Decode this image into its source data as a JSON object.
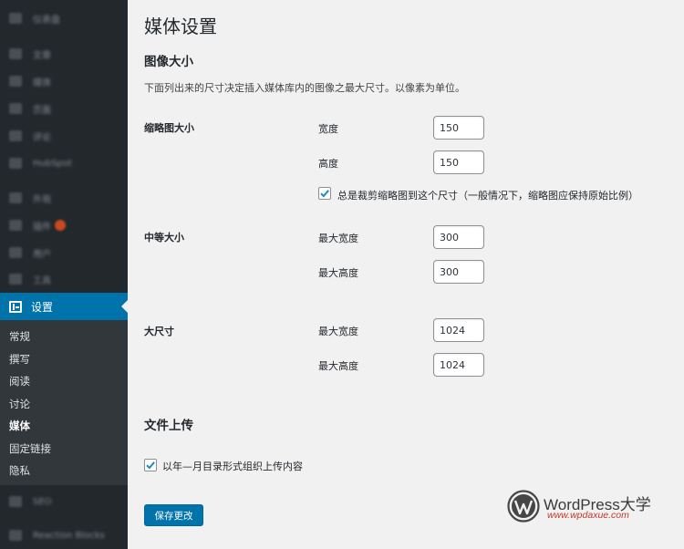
{
  "sidebar": {
    "menu": [
      {
        "label": "仪表盘",
        "icon": "dashboard-icon"
      },
      {
        "label": "文章",
        "icon": "pin-icon"
      },
      {
        "label": "媒体",
        "icon": "media-icon"
      },
      {
        "label": "页面",
        "icon": "page-icon"
      },
      {
        "label": "评论",
        "icon": "comments-icon"
      },
      {
        "label": "HubSpot",
        "icon": "hubspot-icon"
      },
      {
        "label": "外观",
        "icon": "appearance-icon"
      },
      {
        "label": "插件",
        "icon": "plugins-icon"
      },
      {
        "label": "用户",
        "icon": "users-icon"
      },
      {
        "label": "工具",
        "icon": "tools-icon"
      }
    ],
    "active": {
      "label": "设置",
      "icon": "settings-icon"
    },
    "submenu": [
      "常规",
      "撰写",
      "阅读",
      "讨论",
      "媒体",
      "固定链接",
      "隐私"
    ],
    "submenu_current": "媒体",
    "bottom_menu": [
      {
        "label": "SEO",
        "icon": "seo-icon"
      },
      {
        "label": "Reaction Blocks",
        "icon": "blocks-icon"
      }
    ]
  },
  "page": {
    "title": "媒体设置",
    "image_sizes": {
      "heading": "图像大小",
      "description": "下面列出来的尺寸决定插入媒体库内的图像之最大尺寸。以像素为单位。",
      "thumbnail": {
        "label": "缩略图大小",
        "width_label": "宽度",
        "width_value": "150",
        "height_label": "高度",
        "height_value": "150",
        "crop_label": "总是裁剪缩略图到这个尺寸（一般情况下，缩略图应保持原始比例）",
        "crop_checked": true
      },
      "medium": {
        "label": "中等大小",
        "max_width_label": "最大宽度",
        "max_width_value": "300",
        "max_height_label": "最大高度",
        "max_height_value": "300"
      },
      "large": {
        "label": "大尺寸",
        "max_width_label": "最大宽度",
        "max_width_value": "1024",
        "max_height_label": "最大高度",
        "max_height_value": "1024"
      }
    },
    "uploads": {
      "heading": "文件上传",
      "organize_label": "以年—月目录形式组织上传内容",
      "organize_checked": true
    },
    "save_label": "保存更改"
  },
  "watermark": {
    "title": "WordPress大学",
    "url": "www.wpdaxue.com"
  },
  "colors": {
    "sidebar_bg": "#23282d",
    "submenu_bg": "#32373c",
    "accent": "#0073aa",
    "checkmark": "#1e8cbe",
    "page_bg": "#f1f1f1"
  }
}
